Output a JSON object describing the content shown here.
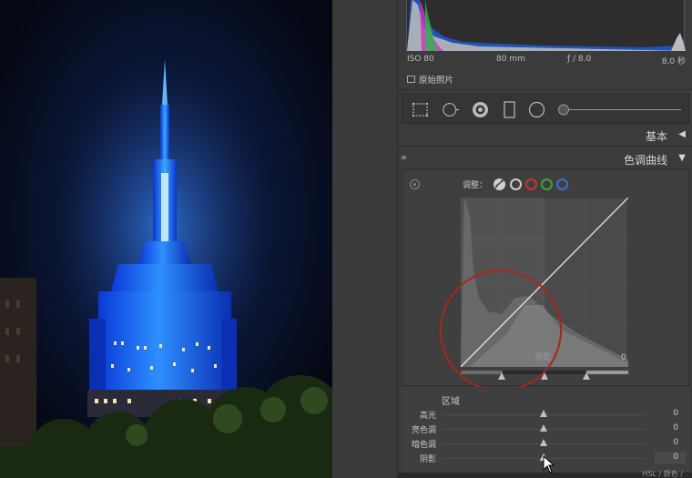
{
  "histogram": {
    "iso": "ISO 80",
    "focal": "80 mm",
    "aperture": "ƒ / 8.0",
    "shutter": "8.0 秒",
    "original_photo_label": "原始照片"
  },
  "tools": [
    "crop-icon",
    "spot-removal-icon",
    "red-eye-icon",
    "graduated-filter-icon",
    "radial-filter-icon",
    "adjustment-brush-icon"
  ],
  "sections": {
    "basic": "基本",
    "tone_curve": "色调曲线"
  },
  "tone_curve": {
    "adjust_label": "调整：",
    "channels": [
      {
        "name": "white-channel",
        "color": "#cccccc"
      },
      {
        "name": "red-channel",
        "color": "#c83232"
      },
      {
        "name": "green-channel",
        "color": "#3aa53a"
      },
      {
        "name": "blue-channel",
        "color": "#3a6fd6"
      }
    ],
    "graph_hint": "阴影",
    "graph_value": "0",
    "region_title": "区域",
    "regions": [
      {
        "label": "高光",
        "value": "0"
      },
      {
        "label": "亮色调",
        "value": "0"
      },
      {
        "label": "暗色调",
        "value": "0"
      },
      {
        "label": "阴影",
        "value": "0"
      }
    ]
  },
  "bottom_hint": "HSL / 颜色 /"
}
